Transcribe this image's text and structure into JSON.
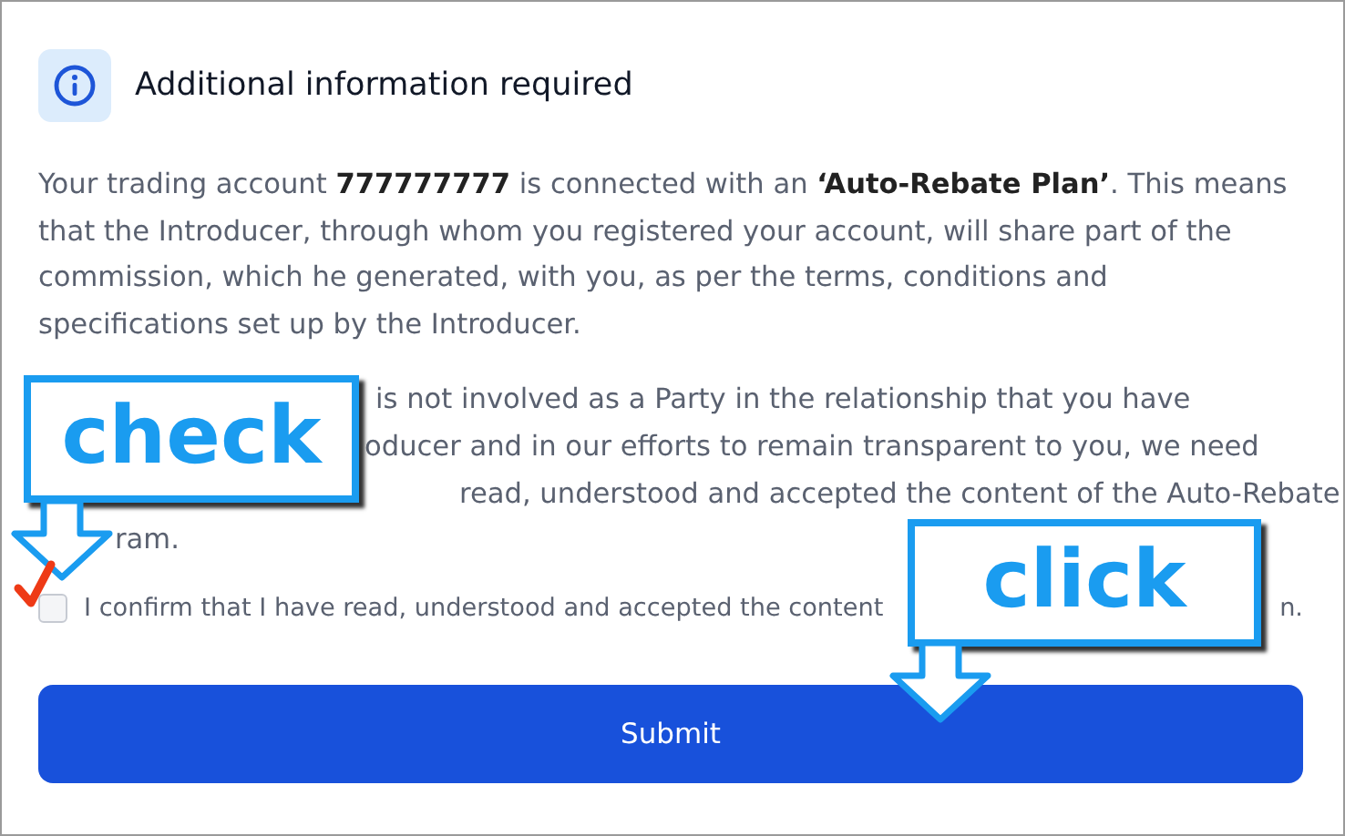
{
  "header": {
    "title": "Additional information required"
  },
  "intro": "Your trading account **777777777** is connected with an **‘Auto-Rebate Plan’**. This means that the Introducer, through whom you registered your account, will share part of the commission, which he generated, with you, as per the terms, conditions and specifications set up by the Introducer.",
  "partly_covered_lines": [
    "is not involved as a Party in the relationship that you have",
    "oducer and in our efforts to remain transparent to you, we need",
    "read, understood and accepted the content of the Auto-Rebate",
    "ram."
  ],
  "confirm": {
    "checked": false,
    "label": "I confirm that I have read, understood and accepted the content",
    "label_tail": "n."
  },
  "submit": {
    "label": "Submit"
  },
  "annotations": [
    {
      "kind": "check",
      "text": "check"
    },
    {
      "kind": "click",
      "text": "click"
    }
  ]
}
